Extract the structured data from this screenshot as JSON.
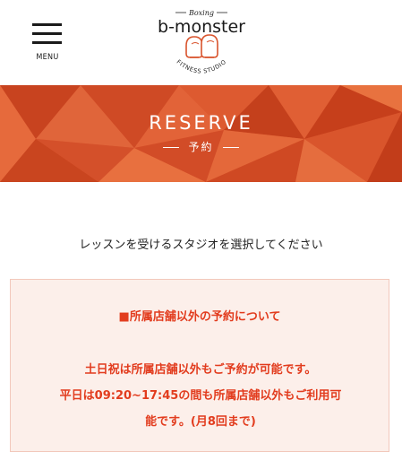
{
  "header": {
    "menu_label": "MENU",
    "logo": {
      "top_text": "Boxing",
      "brand": "b-monster",
      "bottom_text": "FITNESS STUDIO"
    }
  },
  "hero": {
    "title": "RESERVE",
    "subtitle": "予約"
  },
  "instruction": "レッスンを受けるスタジオを選択してください",
  "notice": {
    "title": "■所属店舗以外の予約について",
    "lines": [
      "土日祝は所属店舗以外もご予約が可能です。",
      "平日は09:20~17:45の間も所属店舗以外もご利用可",
      "能です。(月8回まで)"
    ]
  },
  "colors": {
    "accent": "#e23c1e",
    "hero_bg": "#d9532c",
    "notice_bg": "#fcefea"
  }
}
